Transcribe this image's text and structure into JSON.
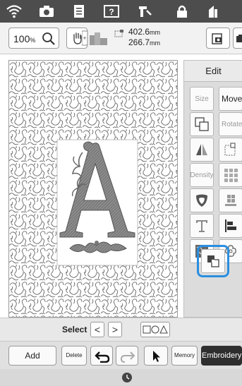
{
  "toolbar": {
    "zoom_value": "100",
    "zoom_unit": "%",
    "size_width": "402.6",
    "size_height": "266.7",
    "size_unit": "mm"
  },
  "icons": {
    "top": [
      "wifi-icon",
      "camera-icon",
      "document-icon",
      "help-icon",
      "needle-icon",
      "lock-icon",
      "home-icon"
    ]
  },
  "edit_panel": {
    "tab_label": "Edit",
    "size_label": "Size",
    "move_label": "Move",
    "rotate_label": "Rotate",
    "density_label": "Density"
  },
  "select_bar": {
    "label": "Select",
    "prev": "<",
    "next": ">"
  },
  "bottom_bar": {
    "add": "Add",
    "delete": "Delete",
    "memory": "Memory",
    "embroidery": "Embroidery"
  },
  "colors": {
    "accent": "#2a8fe0",
    "top_bar": "#4d4d4d",
    "embroidery_button": "#2e2e2e"
  }
}
